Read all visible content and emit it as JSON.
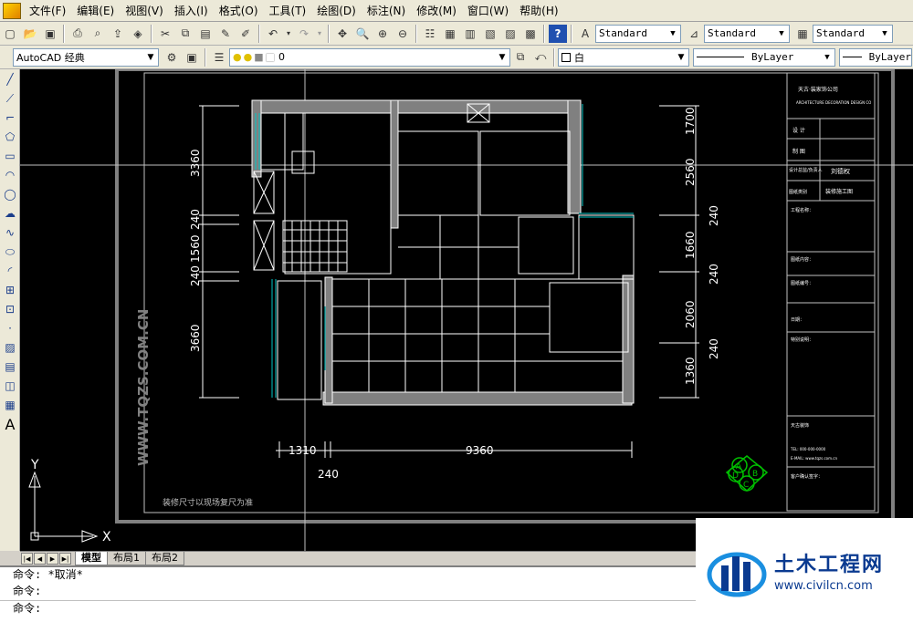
{
  "menu": {
    "items": [
      "文件(F)",
      "编辑(E)",
      "视图(V)",
      "插入(I)",
      "格式(O)",
      "工具(T)",
      "绘图(D)",
      "标注(N)",
      "修改(M)",
      "窗口(W)",
      "帮助(H)"
    ]
  },
  "styles_toolbar": {
    "text_style": "Standard",
    "dim_style": "Standard",
    "table_style": "Standard"
  },
  "layers_toolbar": {
    "workspace": "AutoCAD 经典",
    "current_layer": "0",
    "color": "白",
    "linetype": "ByLayer",
    "lineweight": "ByLayer"
  },
  "drawing": {
    "dims_left": [
      "3360",
      "240",
      "1560",
      "240",
      "3660"
    ],
    "dims_right": [
      "1700",
      "2560",
      "240",
      "1660",
      "240",
      "2060",
      "240",
      "1360"
    ],
    "dims_bottom": [
      "1310",
      "9360"
    ],
    "dim_240": "240",
    "watermark_vertical": "WWW.TQZS.COM.CN",
    "bottom_note": "装修尺寸以现场复尺为准",
    "ucs_x": "X",
    "ucs_y": "Y",
    "title_block": {
      "company": "天古·装家饰公司",
      "company_en": "ARCHITECTURE DECORATION DESIGN CO",
      "design_label": "设 计",
      "draw_label": "制 图",
      "manager_label": "设计总监/负责人",
      "manager_name": "刘德权",
      "drawing_type_label": "图纸类别",
      "drawing_type": "装修施工图",
      "project_label": "工程名称：",
      "content_label": "图纸内容：",
      "number_label": "图纸编号：",
      "date_label": "日期：",
      "notes_label": "特别说明：",
      "contact_label": "天古装饰",
      "tel": "TEL: 000-000-0000",
      "email": "E-MAIL: www.tqzs.com.cn",
      "sign_label": "客户确认签字："
    },
    "compass": [
      "A",
      "B",
      "C",
      "D"
    ]
  },
  "layout_tabs": {
    "tabs": [
      "模型",
      "布局1",
      "布局2"
    ],
    "active": "模型"
  },
  "command": {
    "line1": "命令: *取消*",
    "line2": "命令:",
    "line3": "命令:"
  },
  "watermark": {
    "title": "土木工程网",
    "url": "www.civilcn.com"
  },
  "colors": {
    "canvas_bg": "#000000",
    "line_white": "#ffffff",
    "wall_gray": "#808080",
    "window_cyan": "#00c8c8",
    "compass_green": "#00c000",
    "brand_blue": "#0a3a90"
  }
}
